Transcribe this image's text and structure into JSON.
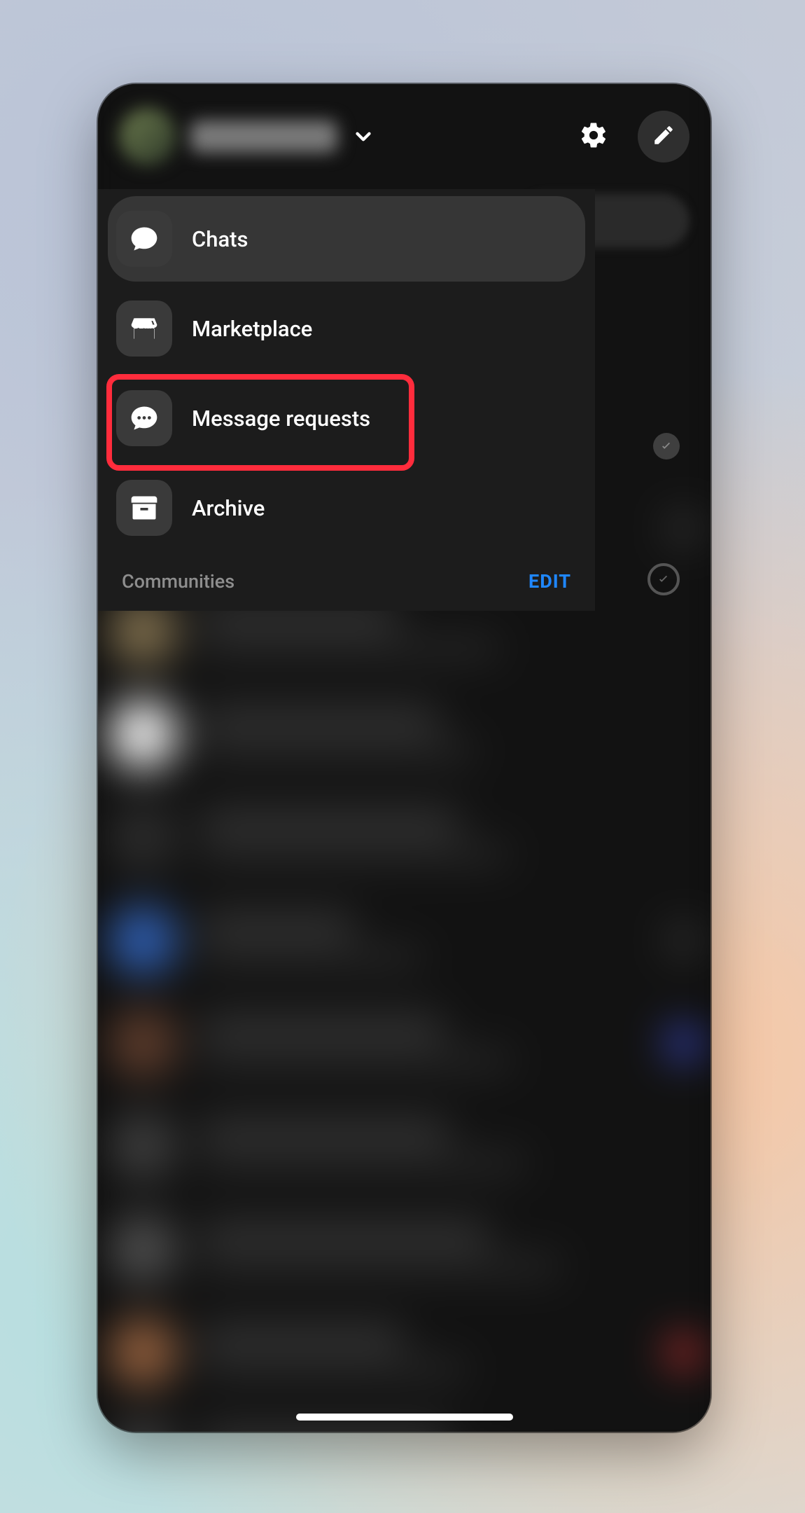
{
  "menu": {
    "items": [
      {
        "label": "Chats",
        "icon": "chats"
      },
      {
        "label": "Marketplace",
        "icon": "marketplace"
      },
      {
        "label": "Message requests",
        "icon": "message-requests"
      },
      {
        "label": "Archive",
        "icon": "archive"
      }
    ],
    "active_index": 0,
    "highlight_index": 2
  },
  "section": {
    "label": "Communities",
    "edit_label": "EDIT"
  },
  "colors": {
    "accent": "#1f87ff",
    "highlight": "#ff2c3c"
  }
}
